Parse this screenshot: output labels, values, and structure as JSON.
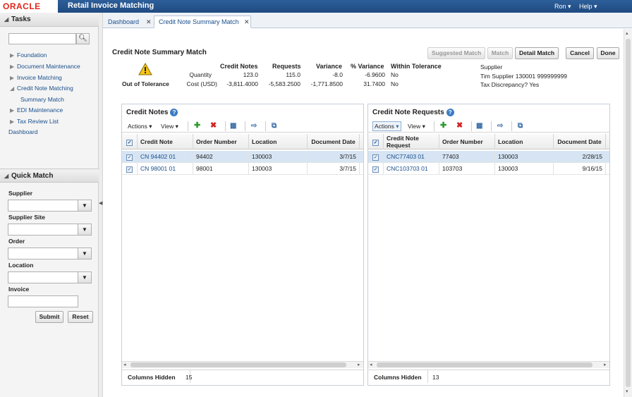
{
  "header": {
    "logo": "ORACLE",
    "app_title": "Retail Invoice Matching",
    "user": "Ron",
    "help": "Help"
  },
  "tasks": {
    "title": "Tasks",
    "search_placeholder": "",
    "items": [
      {
        "label": "Foundation",
        "expanded": false
      },
      {
        "label": "Document Maintenance",
        "expanded": false
      },
      {
        "label": "Invoice Matching",
        "expanded": false
      },
      {
        "label": "Credit Note Matching",
        "expanded": true
      },
      {
        "label": "Summary Match",
        "child": true
      },
      {
        "label": "EDI Maintenance",
        "expanded": false
      },
      {
        "label": "Tax Review List",
        "expanded": false
      },
      {
        "label": "Dashboard",
        "leaf": true
      }
    ]
  },
  "quick_match": {
    "title": "Quick Match",
    "supplier": "Supplier",
    "supplier_site": "Supplier Site",
    "order": "Order",
    "location": "Location",
    "invoice": "Invoice",
    "submit": "Submit",
    "reset": "Reset"
  },
  "tabs": [
    {
      "label": "Dashboard",
      "active": false
    },
    {
      "label": "Credit Note Summary Match",
      "active": true
    }
  ],
  "page": {
    "title": "Credit Note Summary Match",
    "buttons": {
      "suggested_match": "Suggested Match",
      "match": "Match",
      "detail_match": "Detail Match",
      "cancel": "Cancel",
      "done": "Done"
    },
    "status": "Out of Tolerance",
    "summary": {
      "headers": [
        "Credit Notes",
        "Requests",
        "Variance",
        "% Variance",
        "Within Tolerance"
      ],
      "rows": [
        {
          "label": "Quantity",
          "values": [
            "123.0",
            "115.0",
            "-8.0",
            "-6.9600",
            "No"
          ]
        },
        {
          "label": "Cost (USD)",
          "values": [
            "-3,811.4000",
            "-5,583.2500",
            "-1,771.8500",
            "31.7400",
            "No"
          ]
        }
      ]
    },
    "supplier_label": "Supplier",
    "supplier_value": "Tim Supplier 130001 999999999",
    "tax_discrepancy": "Tax Discrepancy? Yes"
  },
  "credit_notes": {
    "title": "Credit Notes",
    "actions": "Actions",
    "view": "View",
    "columns": [
      "Credit Note",
      "Order Number",
      "Location",
      "Document Date"
    ],
    "rows": [
      [
        "CN 94402 01",
        "94402",
        "130003",
        "3/7/15"
      ],
      [
        "CN 98001 01",
        "98001",
        "130003",
        "3/7/15"
      ]
    ],
    "columns_hidden_label": "Columns Hidden",
    "columns_hidden": "15"
  },
  "credit_note_requests": {
    "title": "Credit Note Requests",
    "actions": "Actions",
    "view": "View",
    "columns": [
      "Credit Note Request",
      "Order Number",
      "Location",
      "Document Date"
    ],
    "rows": [
      [
        "CNC77403 01",
        "77403",
        "130003",
        "2/28/15"
      ],
      [
        "CNC103703 01",
        "103703",
        "130003",
        "9/16/15"
      ]
    ],
    "columns_hidden_label": "Columns Hidden",
    "columns_hidden": "13"
  }
}
